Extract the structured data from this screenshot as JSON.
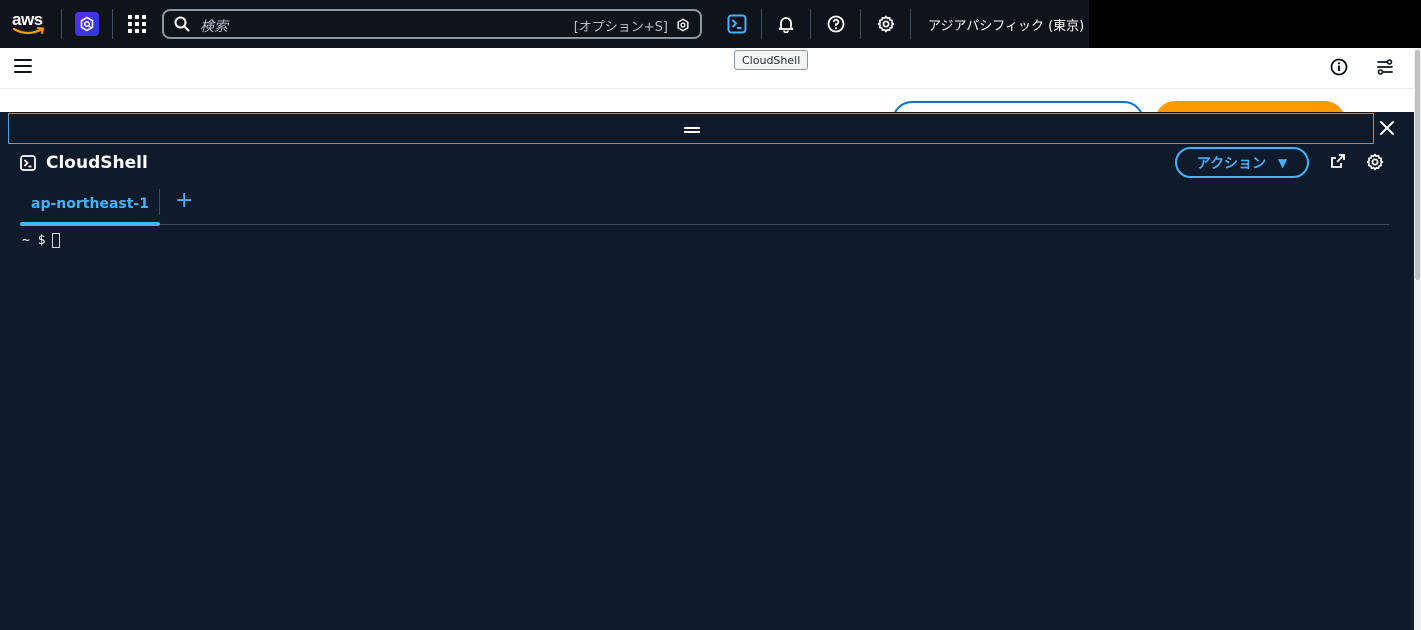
{
  "topnav": {
    "logo_text": "aws",
    "search_placeholder": "検索",
    "search_shortcut": "[オプション+S]",
    "region_label": "アジアパシフィック (東京)",
    "icons": [
      "q-developer-icon",
      "services-grid-icon",
      "search-icon",
      "cloudshell-icon",
      "notifications-icon",
      "help-icon",
      "settings-icon"
    ]
  },
  "tooltip": {
    "text": "CloudShell"
  },
  "subbar": {
    "icons": [
      "menu-icon",
      "info-icon",
      "split-panel-icon"
    ]
  },
  "cloudshell": {
    "title": "CloudShell",
    "actions_label": "アクション",
    "tabs": [
      {
        "label": "ap-northeast-1",
        "active": true
      }
    ],
    "add_tab_label": "+",
    "prompt": "~ $",
    "colors": {
      "background": "#0f1b2a",
      "accent": "#42b4ff"
    }
  }
}
